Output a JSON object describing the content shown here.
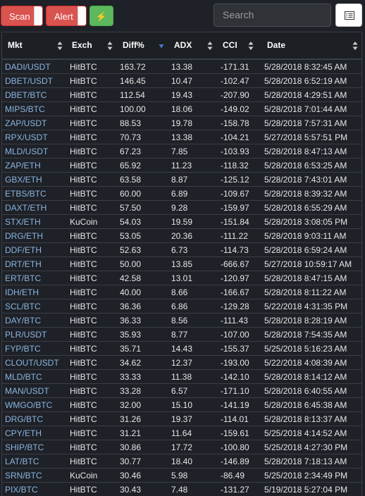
{
  "toolbar": {
    "scan_label": "Scan",
    "alert_label": "Alert",
    "bolt_icon": "lightning-bolt-icon",
    "search_placeholder": "Search",
    "list_icon": "list-view-icon",
    "colors": {
      "red": "#d9534f",
      "green": "#5cb85c"
    }
  },
  "table": {
    "columns": [
      "Mkt",
      "Exch",
      "Diff%",
      "ADX",
      "CCI",
      "Date"
    ],
    "sorted_by": "Diff%",
    "sort_direction": "descending",
    "rows": [
      [
        "DADI/USDT",
        "HitBTC",
        "163.72",
        "13.38",
        "-171.31",
        "5/28/2018 8:32:45 AM"
      ],
      [
        "DBET/USDT",
        "HitBTC",
        "146.45",
        "10.47",
        "-102.47",
        "5/28/2018 6:52:19 AM"
      ],
      [
        "DBET/BTC",
        "HitBTC",
        "112.54",
        "19.43",
        "-207.90",
        "5/28/2018 4:29:51 AM"
      ],
      [
        "MIPS/BTC",
        "HitBTC",
        "100.00",
        "18.06",
        "-149.02",
        "5/28/2018 7:01:44 AM"
      ],
      [
        "ZAP/USDT",
        "HitBTC",
        "88.53",
        "19.78",
        "-158.78",
        "5/28/2018 7:57:31 AM"
      ],
      [
        "RPX/USDT",
        "HitBTC",
        "70.73",
        "13.38",
        "-104.21",
        "5/27/2018 5:57:51 PM"
      ],
      [
        "MLD/USDT",
        "HitBTC",
        "67.23",
        "7.85",
        "-103.93",
        "5/28/2018 8:47:13 AM"
      ],
      [
        "ZAP/ETH",
        "HitBTC",
        "65.92",
        "11.23",
        "-118.32",
        "5/28/2018 6:53:25 AM"
      ],
      [
        "GBX/ETH",
        "HitBTC",
        "63.58",
        "8.87",
        "-125.12",
        "5/28/2018 7:43:01 AM"
      ],
      [
        "ETBS/BTC",
        "HitBTC",
        "60.00",
        "6.89",
        "-109.67",
        "5/28/2018 8:39:32 AM"
      ],
      [
        "DAXT/ETH",
        "HitBTC",
        "57.50",
        "9.28",
        "-159.97",
        "5/28/2018 6:55:29 AM"
      ],
      [
        "STX/ETH",
        "KuCoin",
        "54.03",
        "19.59",
        "-151.84",
        "5/28/2018 3:08:05 PM"
      ],
      [
        "DRG/ETH",
        "HitBTC",
        "53.05",
        "20.36",
        "-111.22",
        "5/28/2018 9:03:11 AM"
      ],
      [
        "DDF/ETH",
        "HitBTC",
        "52.63",
        "6.73",
        "-114.73",
        "5/28/2018 6:59:24 AM"
      ],
      [
        "DRT/ETH",
        "HitBTC",
        "50.00",
        "13.85",
        "-666.67",
        "5/27/2018 10:59:17 AM"
      ],
      [
        "ERT/BTC",
        "HitBTC",
        "42.58",
        "13.01",
        "-120.97",
        "5/28/2018 8:47:15 AM"
      ],
      [
        "IDH/ETH",
        "HitBTC",
        "40.00",
        "8.66",
        "-166.67",
        "5/28/2018 8:11:22 AM"
      ],
      [
        "SCL/BTC",
        "HitBTC",
        "36.36",
        "6.86",
        "-129.28",
        "5/22/2018 4:31:35 PM"
      ],
      [
        "DAY/BTC",
        "HitBTC",
        "36.33",
        "8.56",
        "-111.43",
        "5/28/2018 8:28:19 AM"
      ],
      [
        "PLR/USDT",
        "HitBTC",
        "35.93",
        "8.77",
        "-107.00",
        "5/28/2018 7:54:35 AM"
      ],
      [
        "FYP/BTC",
        "HitBTC",
        "35.71",
        "14.43",
        "-155.37",
        "5/25/2018 5:16:23 AM"
      ],
      [
        "CLOUT/USDT",
        "HitBTC",
        "34.62",
        "12.37",
        "-193.00",
        "5/22/2018 4:08:39 AM"
      ],
      [
        "MLD/BTC",
        "HitBTC",
        "33.33",
        "11.38",
        "-142.10",
        "5/28/2018 8:14:12 AM"
      ],
      [
        "MAN/USDT",
        "HitBTC",
        "33.28",
        "6.57",
        "-171.10",
        "5/28/2018 6:40:55 AM"
      ],
      [
        "WMGO/BTC",
        "HitBTC",
        "32.00",
        "15.10",
        "-141.19",
        "5/28/2018 6:45:38 AM"
      ],
      [
        "DRG/BTC",
        "HitBTC",
        "31.26",
        "19.37",
        "-114.01",
        "5/28/2018 8:13:37 AM"
      ],
      [
        "CPY/ETH",
        "HitBTC",
        "31.21",
        "11.64",
        "-159.61",
        "5/25/2018 4:14:52 AM"
      ],
      [
        "SHIP/BTC",
        "HitBTC",
        "30.86",
        "17.72",
        "-100.80",
        "5/25/2018 4:27:30 PM"
      ],
      [
        "LAT/BTC",
        "HitBTC",
        "30.77",
        "18.40",
        "-146.89",
        "5/28/2018 7:18:13 AM"
      ],
      [
        "SRN/BTC",
        "KuCoin",
        "30.46",
        "5.98",
        "-86.49",
        "5/25/2018 2:34:49 PM"
      ],
      [
        "PIX/BTC",
        "HitBTC",
        "30.43",
        "7.48",
        "-131.27",
        "5/19/2018 5:27:04 PM"
      ]
    ]
  }
}
